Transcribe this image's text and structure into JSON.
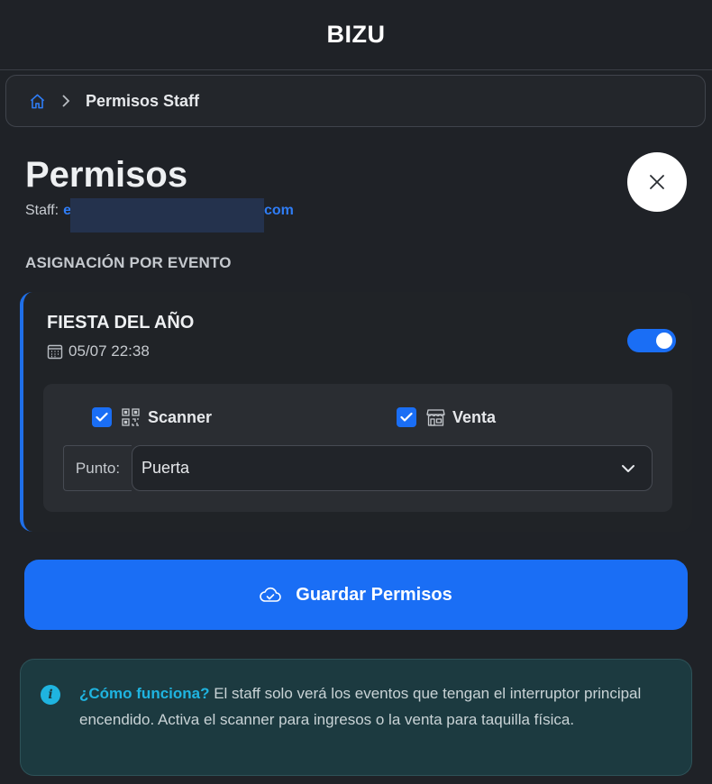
{
  "app": {
    "brand": "BIZU"
  },
  "breadcrumb": {
    "home_icon": "home-icon",
    "separator_icon": "chevron-right-icon",
    "current": "Permisos Staff"
  },
  "page": {
    "title": "Permisos",
    "staff_label": "Staff:",
    "staff_email_visible_start": "e",
    "staff_email_visible_end": "com",
    "close_icon": "close-icon"
  },
  "section": {
    "heading": "ASIGNACIÓN POR EVENTO"
  },
  "events": [
    {
      "name": "FIESTA DEL AÑO",
      "date": "05/07 22:38",
      "enabled": true,
      "permissions": {
        "scanner": {
          "label": "Scanner",
          "checked": true,
          "icon": "qr-code-icon"
        },
        "venta": {
          "label": "Venta",
          "checked": true,
          "icon": "shop-icon"
        }
      },
      "punto": {
        "label": "Punto:",
        "value": "Puerta"
      }
    }
  ],
  "actions": {
    "save_label": "Guardar Permisos",
    "save_icon": "cloud-check-icon"
  },
  "info": {
    "lead": "¿Cómo funciona?",
    "text": "El staff solo verá los eventos que tengan el interruptor principal encendido. Activa el scanner para ingresos o la venta para taquilla física."
  },
  "colors": {
    "background": "#1f2227",
    "accent": "#1a6ef5",
    "info_accent": "#1fb4e0",
    "info_background": "#1c3a40"
  }
}
